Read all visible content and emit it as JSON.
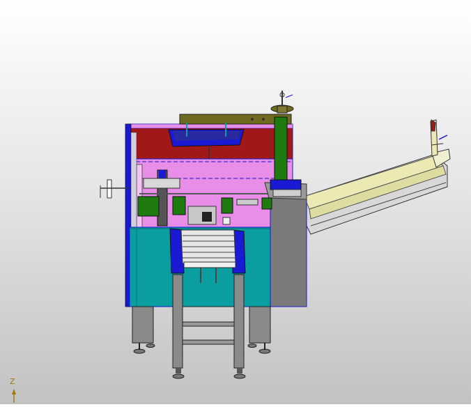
{
  "viewport": {
    "background_top": "#ffffff",
    "background_bottom": "#c2c2c2"
  },
  "model": {
    "colors": {
      "frame_teal": "#0a9ea0",
      "panel_pink": "#e88ee8",
      "panel_red": "#a11818",
      "conveyor_cream": "#ece9b4",
      "post_green": "#1f7a10",
      "outline_blue": "#1a1ad4",
      "side_cabinet_gray": "#7a7a7a",
      "leg_gray": "#8a8a8a",
      "roller_white": "#e6e6e6",
      "olive_bar": "#6e6a20"
    }
  },
  "triad": {
    "axis_label": "Z",
    "color": "#a07a10"
  }
}
